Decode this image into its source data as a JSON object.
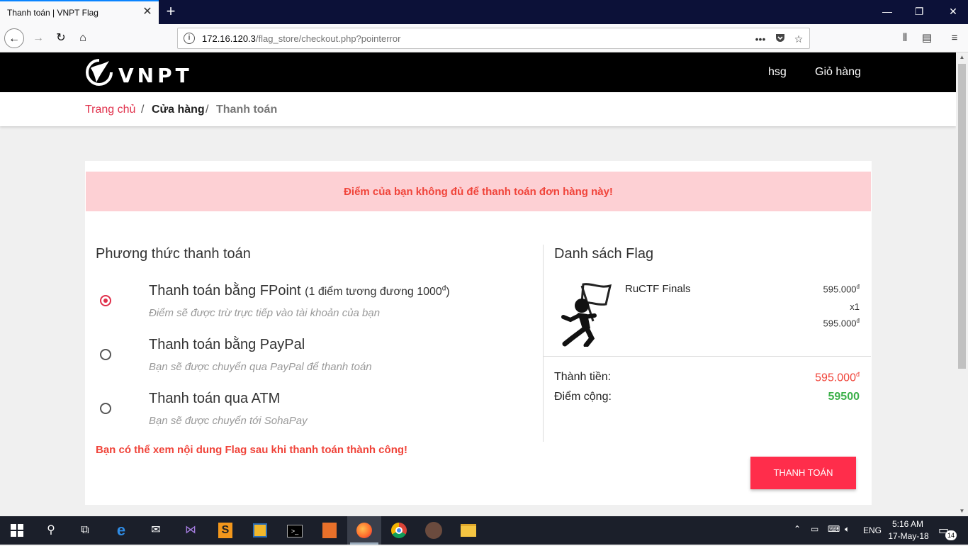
{
  "browser": {
    "tab_title": "Thanh toán | VNPT Flag",
    "url_host": "172.16.120.3",
    "url_path": "/flag_store/checkout.php?pointerror"
  },
  "header": {
    "logo_text": "VNPT",
    "user_link": "hsg",
    "cart_link": "Giỏ hàng"
  },
  "breadcrumb": {
    "home": "Trang chủ",
    "store": "Cửa hàng",
    "current": "Thanh toán",
    "separator": "/"
  },
  "alert": {
    "message": "Điểm của bạn không đủ để thanh toán đơn hàng này!"
  },
  "payment": {
    "title": "Phương thức thanh toán",
    "options": [
      {
        "title": "Thanh toán bằng FPoint",
        "extra": "(1 điểm tương đương 1000",
        "extra_sup": "đ",
        "extra_end": ")",
        "subtitle": "Điểm sẽ được trừ trực tiếp vào tài khoản của bạn",
        "selected": true
      },
      {
        "title": "Thanh toán bằng PayPal",
        "subtitle": "Bạn sẽ được chuyển qua PayPal để thanh toán",
        "selected": false
      },
      {
        "title": "Thanh toán qua ATM",
        "subtitle": "Bạn sẽ được chuyển tới SohaPay",
        "selected": false
      }
    ],
    "note": "Bạn có thể xem nội dung Flag sau khi thanh toán thành công!"
  },
  "cart": {
    "title": "Danh sách Flag",
    "items": [
      {
        "name": "RuCTF Finals",
        "unit_price": "595.000",
        "qty": "x1",
        "total": "595.000",
        "currency": "đ"
      }
    ],
    "subtotal_label": "Thành tiền:",
    "subtotal_value": "595.000",
    "currency": "đ",
    "points_label": "Điểm cộng:",
    "points_value": "59500",
    "pay_button": "THANH TOÁN"
  },
  "taskbar": {
    "language": "ENG",
    "time": "5:16 AM",
    "date": "17-May-18",
    "notifications": "14"
  },
  "colors": {
    "accent": "#ff2d4b",
    "alert_bg": "#fdd0d4",
    "alert_text": "#f0443a",
    "points": "#3cb04a"
  }
}
